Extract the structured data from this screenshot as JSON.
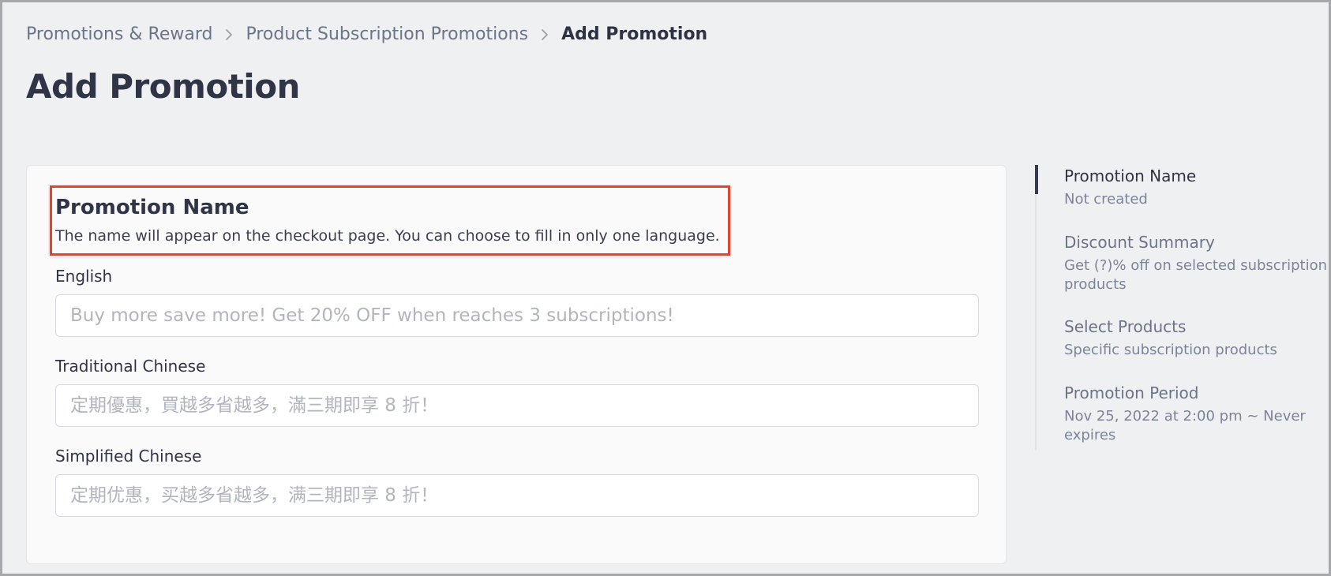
{
  "breadcrumb": {
    "items": [
      "Promotions & Reward",
      "Product Subscription Promotions",
      "Add Promotion"
    ]
  },
  "page": {
    "title": "Add Promotion"
  },
  "form": {
    "section_title": "Promotion Name",
    "section_desc": "The name will appear on the checkout page. You can choose to fill in only one language.",
    "fields": [
      {
        "label": "English",
        "value": "",
        "placeholder": "Buy more save more! Get 20% OFF when reaches 3 subscriptions!"
      },
      {
        "label": "Traditional Chinese",
        "value": "",
        "placeholder": "定期優惠，買越多省越多，滿三期即享 8 折！"
      },
      {
        "label": "Simplified Chinese",
        "value": "",
        "placeholder": "定期优惠，买越多省越多，满三期即享 8 折！"
      }
    ]
  },
  "sidebar": {
    "items": [
      {
        "title": "Promotion Name",
        "subtitle": "Not created"
      },
      {
        "title": "Discount Summary",
        "subtitle": "Get (?)% off on selected subscription products"
      },
      {
        "title": "Select Products",
        "subtitle": "Specific subscription products"
      },
      {
        "title": "Promotion Period",
        "subtitle": "Nov 25, 2022 at 2:00 pm ~ Never expires"
      }
    ]
  },
  "colors": {
    "highlight": "#e0452f",
    "text_primary": "#2f3446",
    "text_secondary": "#6b7489",
    "background": "#eff0f2"
  }
}
